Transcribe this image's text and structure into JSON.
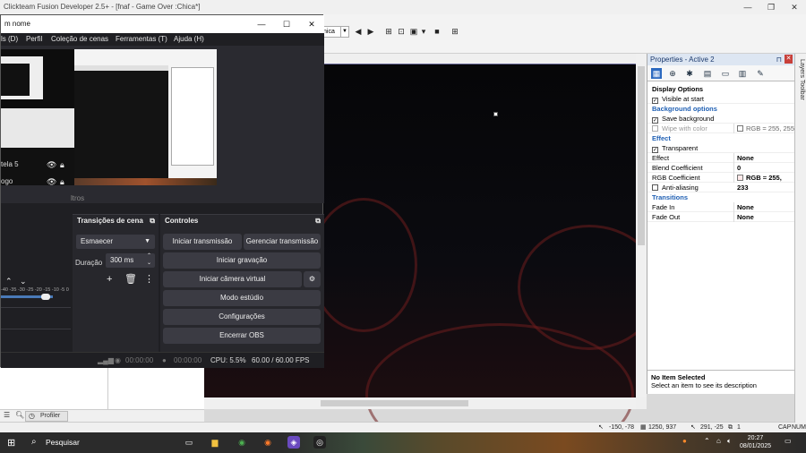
{
  "ctf": {
    "title": "Clickteam Fusion Developer 2.5+ - [fnaf - Game Over :Chica*]",
    "window_controls": [
      "—",
      "❐",
      "✕"
    ],
    "toolbar_combo": "nica",
    "status": {
      "coords1": "-150, -78",
      "coords2": "1250, 937",
      "coords3": "291, -25",
      "layer": "1",
      "caps": "CAP",
      "num": "NUM"
    },
    "profiler_tab": "Profiler"
  },
  "props": {
    "title": "Properties - Active 2",
    "sections": {
      "display_options": "Display Options",
      "visible_at_start": "Visible at start",
      "background_options": "Background options",
      "save_background": "Save background",
      "wipe_with_color": "Wipe with color",
      "wipe_rgb": "RGB = 255, 255",
      "effect_cat": "Effect",
      "transparent": "Transparent",
      "effect_label": "Effect",
      "effect_value": "None",
      "blend_label": "Blend Coefficient",
      "blend_value": "0",
      "rgb_coef_label": "RGB Coefficient",
      "rgb_coef_value": "RGB = 255, 233",
      "antialiasing": "Anti-aliasing",
      "transitions_cat": "Transitions",
      "fade_in_label": "Fade In",
      "fade_in_value": "None",
      "fade_out_label": "Fade Out",
      "fade_out_value": "None"
    },
    "desc_title": "No Item Selected",
    "desc_text": "Select an item to see its description",
    "layers_toolbar": "Layers Toolbar"
  },
  "obs": {
    "title": "m nome",
    "window_controls": [
      "—",
      "☐",
      "✕"
    ],
    "menu": [
      "ls (D)",
      "Perfil",
      "Coleção de cenas",
      "Ferramentas (T)",
      "Ajuda (H)"
    ],
    "sources": [
      "tela 5",
      "ogo"
    ],
    "filters_label": "ltros",
    "transitions": {
      "title": "Transições de cena",
      "selected": "Esmaecer",
      "duration_label": "Duração",
      "duration_value": "300 ms"
    },
    "controls": {
      "title": "Controles",
      "start_stream": "Iniciar transmissão",
      "manage_stream": "Gerenciar transmissão",
      "start_recording": "Iniciar gravação",
      "start_virtual_cam": "Iniciar câmera virtual",
      "studio_mode": "Modo estúdio",
      "settings": "Configurações",
      "exit": "Encerrar OBS"
    },
    "mixer_scale": "-40 -35 -30 -25 -20 -15 -10 -5 0",
    "status": {
      "stream_time": "00:00:00",
      "rec_time": "00:00:00",
      "cpu": "CPU: 5.5%",
      "fps": "60.00 / 60.00 FPS"
    }
  },
  "taskbar": {
    "search": "Pesquisar",
    "time": "20:27",
    "date": "08/01/2025"
  }
}
